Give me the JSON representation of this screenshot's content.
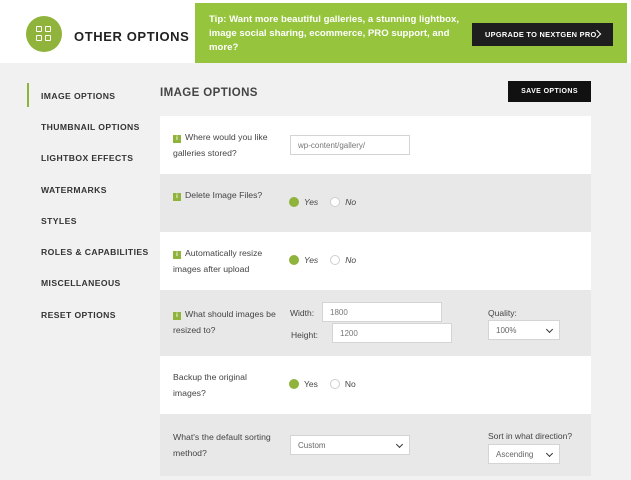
{
  "header": {
    "title": "OTHER OPTIONS",
    "logo_icon": "grid-icon",
    "tip_text": "Tip: Want more beautiful galleries, a stunning lightbox, image social sharing, ecommerce, PRO support, and more?",
    "upgrade_label": "UPGRADE TO NEXTGEN PRO",
    "accent": "#96c43c"
  },
  "sidebar": {
    "items": [
      {
        "label": "IMAGE OPTIONS"
      },
      {
        "label": "THUMBNAIL OPTIONS"
      },
      {
        "label": "LIGHTBOX EFFECTS"
      },
      {
        "label": "WATERMARKS"
      },
      {
        "label": "STYLES"
      },
      {
        "label": "ROLES & CAPABILITIES"
      },
      {
        "label": "MISCELLANEOUS"
      },
      {
        "label": "RESET OPTIONS"
      }
    ]
  },
  "main": {
    "title": "IMAGE OPTIONS",
    "save_label": "SAVE OPTIONS",
    "gallery_path": {
      "label": "Where would you like galleries stored?",
      "value": "wp-content/gallery/"
    },
    "delete_files": {
      "label": "Delete Image Files?",
      "yes": "Yes",
      "no": "No"
    },
    "auto_resize": {
      "label": "Automatically resize images after upload",
      "yes": "Yes",
      "no": "No"
    },
    "resize_to": {
      "label": "What should images be resized to?",
      "width_label": "Width:",
      "width_value": "1800",
      "height_label": "Height:",
      "height_value": "1200",
      "quality_label": "Quality:",
      "quality_value": "100%"
    },
    "backup": {
      "label": "Backup the original images?",
      "yes": "Yes",
      "no": "No"
    },
    "sorting": {
      "label": "What's the default sorting method?",
      "method_value": "Custom",
      "direction_label": "Sort in what direction?",
      "direction_value": "Ascending"
    }
  }
}
